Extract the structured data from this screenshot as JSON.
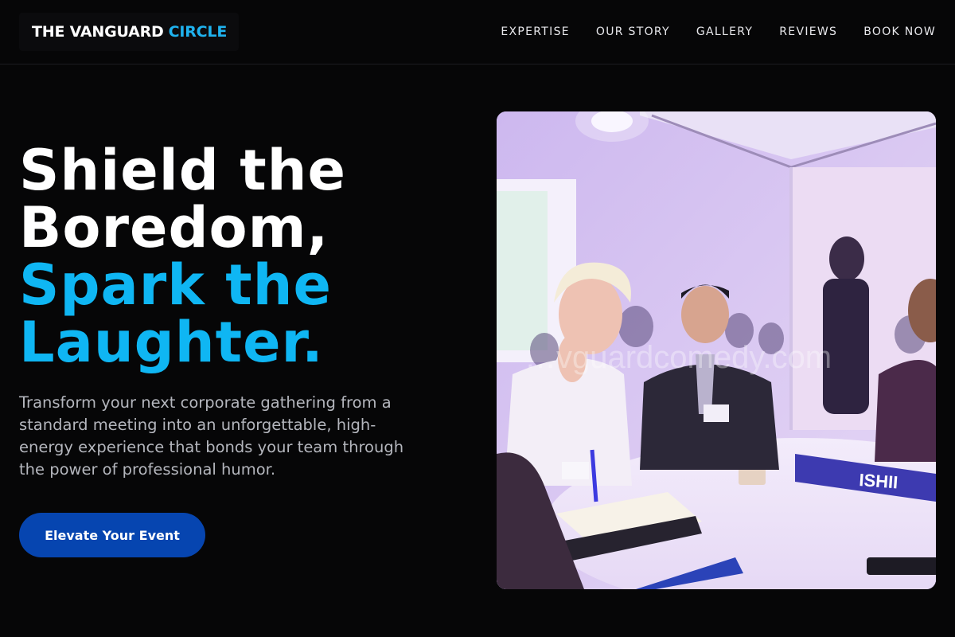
{
  "brand": {
    "name_white": "THE VANGUARD",
    "name_blue": "CIRCLE"
  },
  "nav": {
    "items": [
      "EXPERTISE",
      "OUR STORY",
      "GALLERY",
      "REVIEWS",
      "BOOK NOW"
    ]
  },
  "hero": {
    "title_lines_white": [
      "Shield the",
      "Boredom,"
    ],
    "title_lines_blue": [
      "Spark the",
      "Laughter."
    ],
    "description": "Transform your next corporate gathering from a standard meeting into an unforgettable, high-energy experience that bonds your team through the power of professional humor.",
    "cta_label": "Elevate Your Event"
  },
  "photo": {
    "name_card_text": "ISHII",
    "watermark": "…vguardcomedy.com"
  },
  "colors": {
    "accent": "#0fb6f3",
    "cta": "#0645b0",
    "background": "#060607"
  }
}
